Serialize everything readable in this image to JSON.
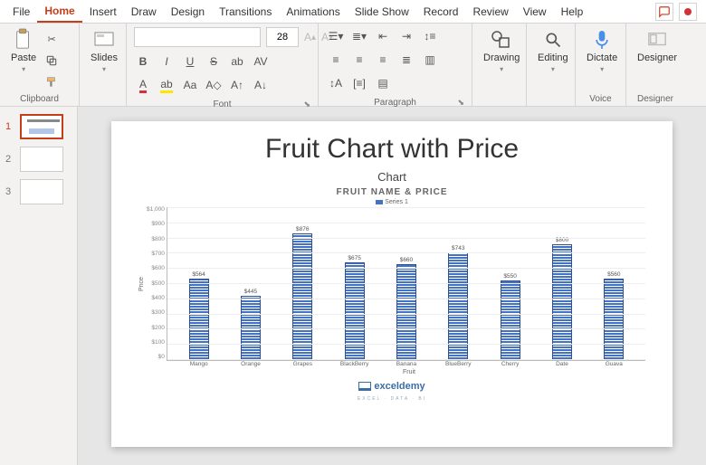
{
  "menu": {
    "items": [
      "File",
      "Home",
      "Insert",
      "Draw",
      "Design",
      "Transitions",
      "Animations",
      "Slide Show",
      "Record",
      "Review",
      "View",
      "Help"
    ],
    "active_index": 1
  },
  "ribbon": {
    "clipboard": {
      "paste": "Paste",
      "label": "Clipboard"
    },
    "slides": {
      "slides": "Slides",
      "label": ""
    },
    "font": {
      "size": "28",
      "label": "Font"
    },
    "paragraph": {
      "label": "Paragraph"
    },
    "drawing": {
      "label": "Drawing",
      "btn": "Drawing"
    },
    "editing": {
      "label": "Editing",
      "btn": "Editing"
    },
    "voice": {
      "label": "Voice",
      "btn": "Dictate"
    },
    "designer": {
      "label": "Designer",
      "btn": "Designer"
    }
  },
  "thumbnails": [
    {
      "num": "1",
      "active": true
    },
    {
      "num": "2",
      "active": false
    },
    {
      "num": "3",
      "active": false
    }
  ],
  "slide": {
    "title": "Fruit Chart with Price",
    "subtitle": "Chart",
    "watermark_brand": "exceldemy",
    "watermark_sub": "EXCEL · DATA · BI"
  },
  "chart_data": {
    "type": "bar",
    "title": "FRUIT NAME & PRICE",
    "legend": "Series 1",
    "xlabel": "Fruit",
    "ylabel": "Price",
    "ylim": [
      0,
      1000
    ],
    "yticks": [
      "$0",
      "$100",
      "$200",
      "$300",
      "$400",
      "$500",
      "$600",
      "$700",
      "$800",
      "$900",
      "$1,000"
    ],
    "categories": [
      "Mango",
      "Orange",
      "Grapes",
      "BlackBerry",
      "Banana",
      "BlueBerry",
      "Cherry",
      "Date",
      "Guava"
    ],
    "values": [
      564,
      445,
      876,
      675,
      660,
      743,
      550,
      800,
      560
    ],
    "value_labels": [
      "$564",
      "$445",
      "$876",
      "$675",
      "$660",
      "$743",
      "$550",
      "$800",
      "$560"
    ]
  }
}
